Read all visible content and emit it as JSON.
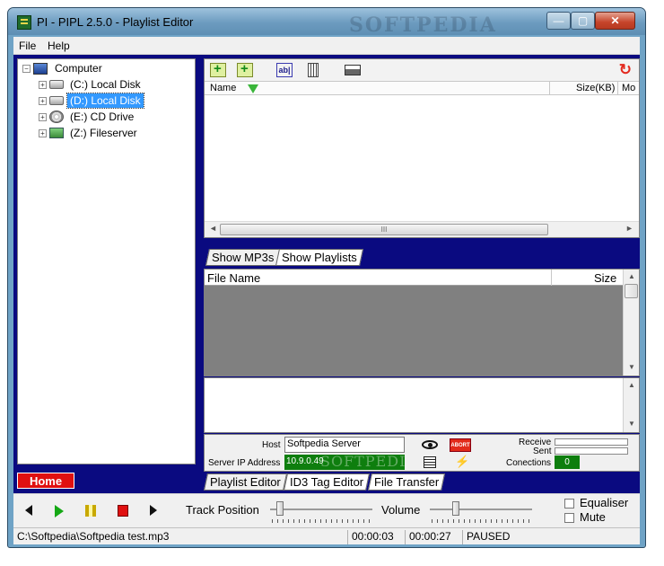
{
  "window": {
    "title": "PI - PIPL 2.5.0 - Playlist Editor",
    "watermark": "SOFTPEDIA",
    "btn_minimize": "—",
    "btn_maximize": "▢",
    "btn_close": "✕"
  },
  "menu": {
    "file": "File",
    "help": "Help"
  },
  "tree": {
    "root": "Computer",
    "items": [
      {
        "label": "(C:)  Local Disk",
        "icon": "hard-disk-icon"
      },
      {
        "label": "(D:)  Local Disk",
        "icon": "hard-disk-icon",
        "selected": true
      },
      {
        "label": "(E:)  CD Drive",
        "icon": "cd-drive-icon"
      },
      {
        "label": "(Z:)  Fileserver",
        "icon": "network-drive-icon"
      }
    ],
    "expand_glyph": "+",
    "collapse_glyph": "−"
  },
  "toolbar": {
    "ab_label": "ab|",
    "refresh_glyph": "↻"
  },
  "file_list": {
    "col_name": "Name",
    "col_size": "Size(KB)",
    "col_mod": "Mo",
    "scroll_left": "◄",
    "scroll_right": "►",
    "thumb_grip": "III"
  },
  "tabs_top": {
    "show_mp3s": "Show MP3s",
    "show_playlists": "Show Playlists"
  },
  "playlist": {
    "col_file_name": "File Name",
    "col_size": "Size",
    "scroll_up": "▲",
    "scroll_down": "▼"
  },
  "network": {
    "host_label": "Host",
    "host_value": "Softpedia Server",
    "ip_label": "Server IP Address",
    "ip_value": "10.9.0.49",
    "ip_watermark": "SOFTPEDIA",
    "abort_label": "ABORT",
    "bolt_glyph": "⚡",
    "receive_label": "Receive",
    "sent_label": "Sent",
    "connections_label": "Conections",
    "connections_value": "0"
  },
  "home_label": "Home",
  "tabs_bottom": {
    "playlist_editor": "Playlist Editor",
    "id3": "ID3 Tag Editor",
    "file_transfer": "File Transfer"
  },
  "player": {
    "track_position_label": "Track Position",
    "volume_label": "Volume",
    "track_position": 0.1,
    "volume": 0.25,
    "equaliser_label": "Equaliser",
    "mute_label": "Mute"
  },
  "status": {
    "path": "C:\\Softpedia\\Softpedia test.mp3",
    "elapsed": "00:00:03",
    "total": "00:00:27",
    "state": "PAUSED"
  }
}
